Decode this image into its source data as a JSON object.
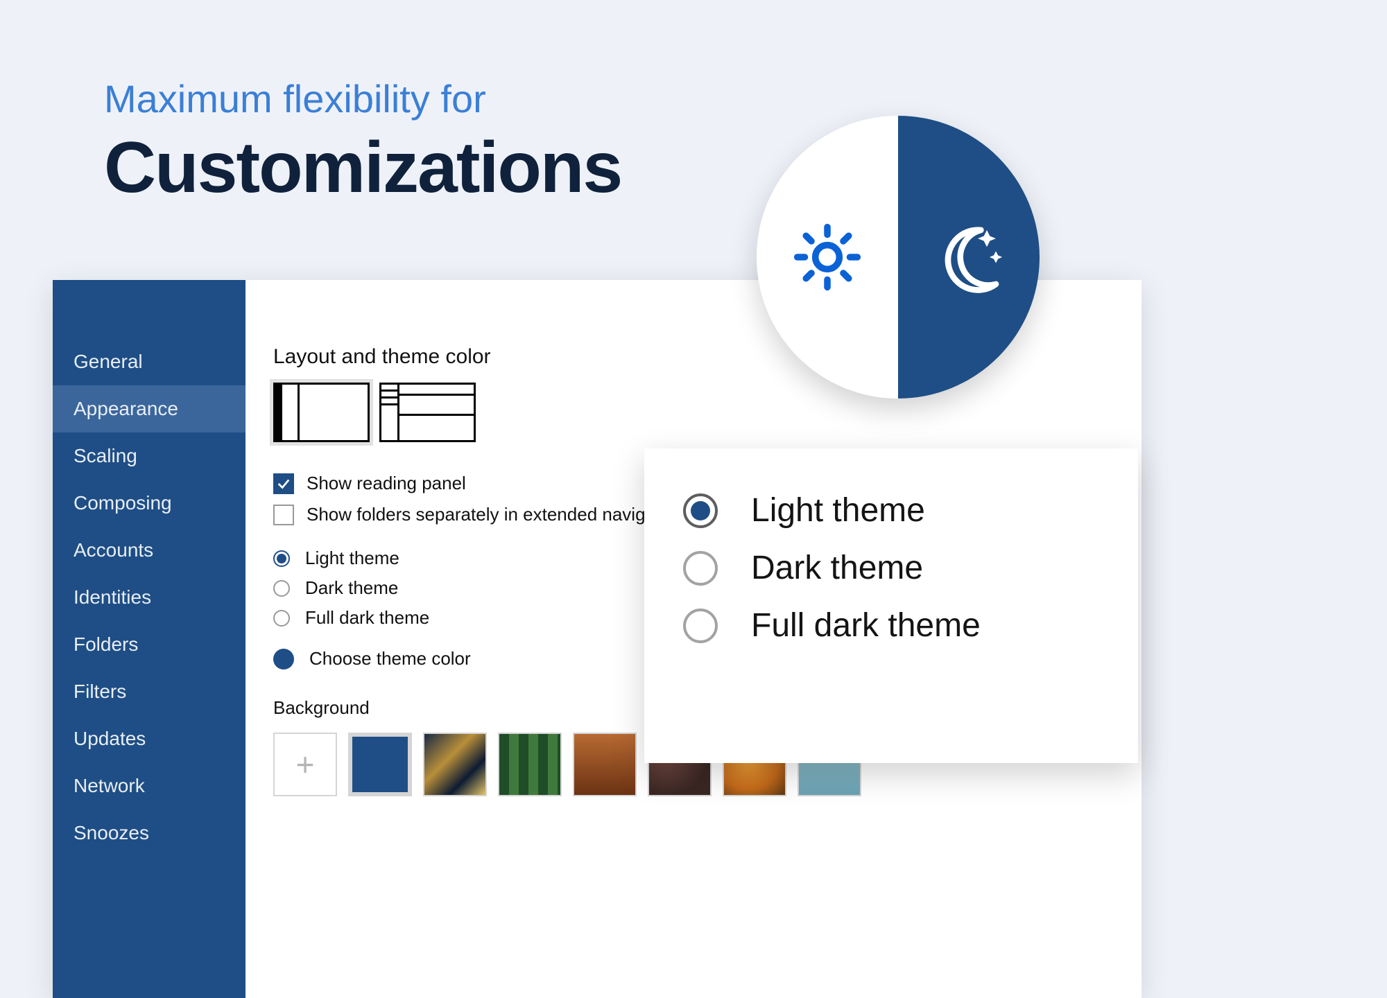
{
  "hero": {
    "subtitle": "Maximum flexibility for",
    "title": "Customizations"
  },
  "sidebar": {
    "items": [
      "General",
      "Appearance",
      "Scaling",
      "Composing",
      "Accounts",
      "Identities",
      "Folders",
      "Filters",
      "Updates",
      "Network",
      "Snoozes"
    ],
    "active_index": 1
  },
  "appearance": {
    "section_title": "Layout and theme color",
    "checkboxes": {
      "show_reading_panel": {
        "label": "Show reading panel",
        "checked": true
      },
      "show_folders_separately": {
        "label": "Show folders separately in extended navigati",
        "checked": false
      }
    },
    "theme_radios": [
      {
        "label": "Light theme",
        "selected": true
      },
      {
        "label": "Dark theme",
        "selected": false
      },
      {
        "label": "Full dark theme",
        "selected": false
      }
    ],
    "choose_theme_color": {
      "label": "Choose theme color",
      "color": "#1e4e85"
    },
    "background": {
      "title": "Background",
      "selected_index": 1
    }
  },
  "selector": {
    "options": [
      {
        "label": "Light theme",
        "selected": true
      },
      {
        "label": "Dark theme",
        "selected": false
      },
      {
        "label": "Full dark theme",
        "selected": false
      }
    ]
  },
  "colors": {
    "brand": "#1e4e85",
    "accent": "#3b7fd6"
  }
}
